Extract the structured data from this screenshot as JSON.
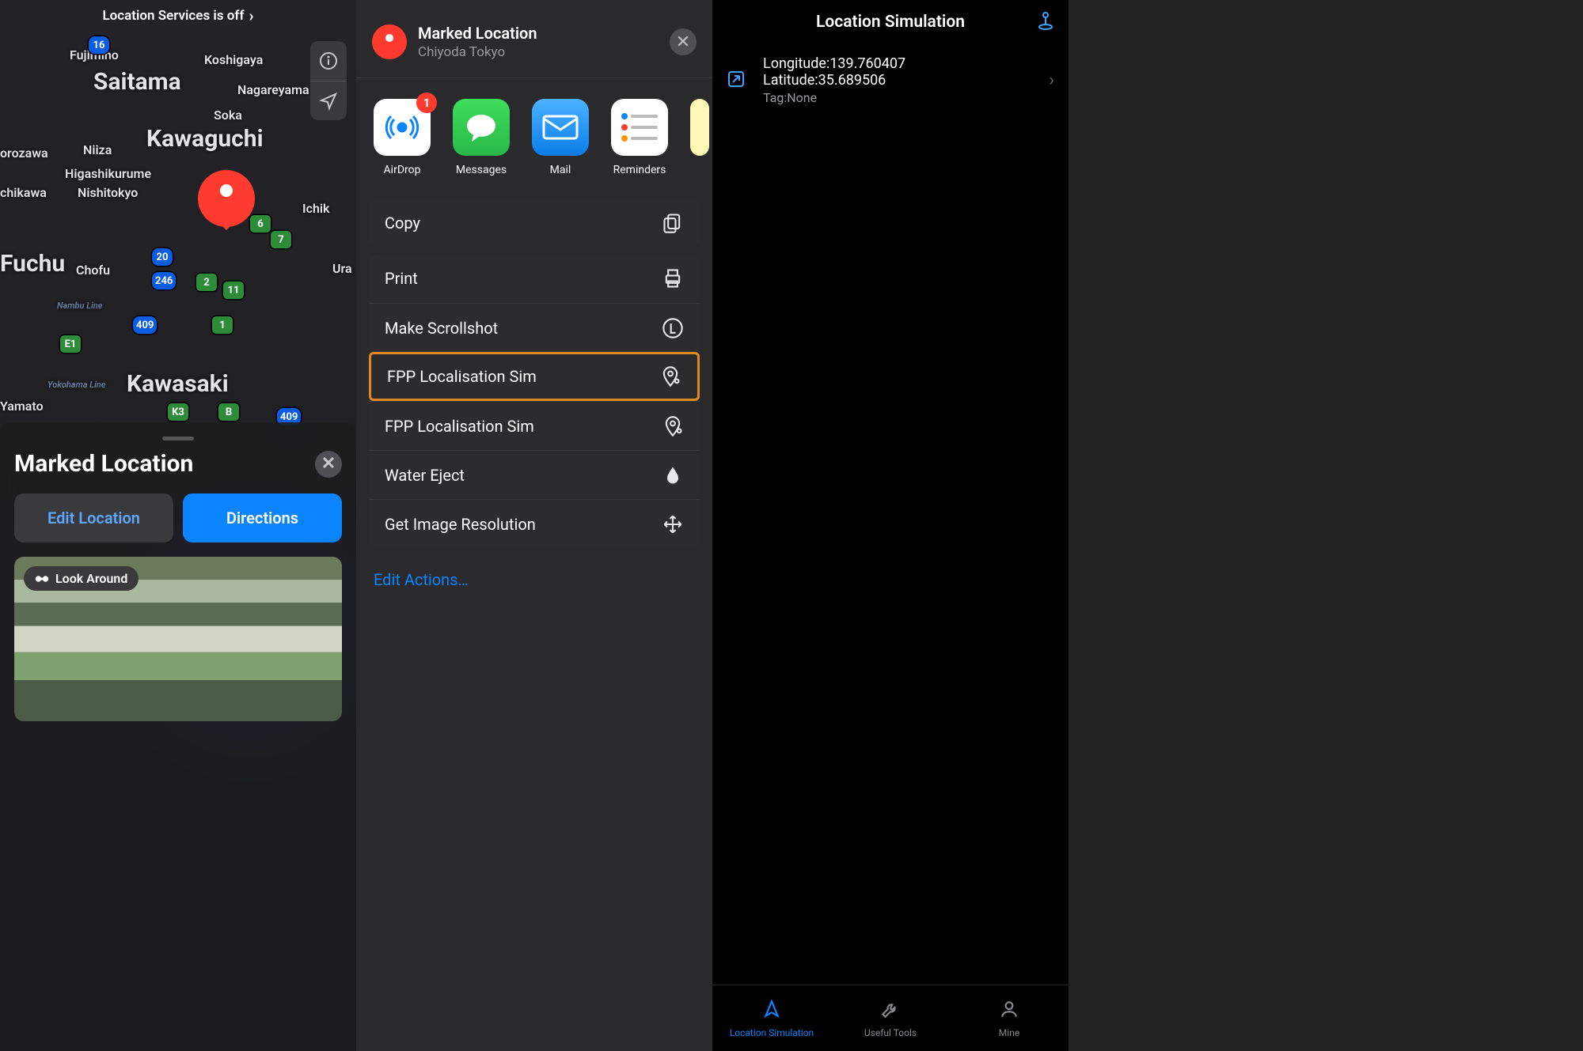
{
  "phone_a": {
    "banner": "Location Services is off",
    "pin_label": "Marked Location",
    "map_places": {
      "saitama": "Saitama",
      "kawaguchi": "Kawaguchi",
      "kawasaki": "Kawasaki",
      "fuchu": "Fuchu",
      "chofu": "Chofu",
      "soka": "Soka",
      "niiza": "Niiza",
      "fujimino": "Fujimino",
      "koshigaya": "Koshigaya",
      "nagareyama": "Nagareyama",
      "higashikurume": "Higashikurume",
      "nishitokyo": "Nishitokyo",
      "torozawa": "orozawa",
      "ichikawa": "chikawa",
      "ichi": "Ichik",
      "ura": "Ura",
      "yamato": "Yamato",
      "yokohama_line": "Yokohama Line",
      "nambu_line": "Nambu Line"
    },
    "shields": {
      "s16": "16",
      "s20": "20",
      "s246": "246",
      "s409a": "409",
      "s409b": "409",
      "s2": "2",
      "s6": "6",
      "s7": "7",
      "s11": "11",
      "s1": "1",
      "sE1": "E1",
      "sK3": "K3",
      "sB": "B"
    },
    "sheet": {
      "title": "Marked Location",
      "edit": "Edit Location",
      "directions": "Directions",
      "look_around": "Look Around"
    }
  },
  "phone_b": {
    "header": {
      "title": "Marked Location",
      "subtitle": "Chiyoda Tokyo"
    },
    "airdrop_badge": "1",
    "apps": {
      "airdrop": "AirDrop",
      "messages": "Messages",
      "mail": "Mail",
      "reminders": "Reminders"
    },
    "actions": {
      "copy": "Copy",
      "print": "Print",
      "scrollshot": "Make Scrollshot",
      "fpp1": "FPP Localisation Sim",
      "fpp2": "FPP Localisation Sim",
      "water": "Water Eject",
      "imgres": "Get Image Resolution"
    },
    "edit_actions": "Edit Actions…"
  },
  "phone_c": {
    "title": "Location Simulation",
    "row": {
      "lon_label": "Longitude:",
      "lon_value": "139.760407",
      "lat_label": "Latitude:",
      "lat_value": "35.689506",
      "tag_label": "Tag:",
      "tag_value": "None"
    },
    "tabs": {
      "a": "Location Simulation",
      "b": "Useful Tools",
      "c": "Mine"
    }
  }
}
